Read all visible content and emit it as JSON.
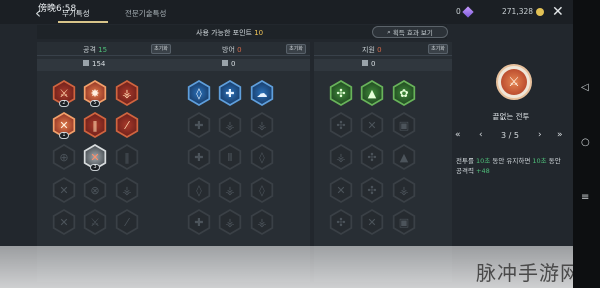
{
  "status": {
    "time": "傍晚6:58"
  },
  "header": {
    "tabs": [
      {
        "label": "무기특성",
        "active": true
      },
      {
        "label": "전문기술특성",
        "active": false
      }
    ],
    "currency": [
      {
        "icon": "gem-icon",
        "value": "0"
      },
      {
        "icon": "gold-coin-icon",
        "value": "271,328"
      }
    ]
  },
  "points": {
    "label": "사용 가능한 포인트",
    "value": "10",
    "effect_button": "획득 효과 보기"
  },
  "columns": [
    {
      "title": "공격",
      "count": "15",
      "reset": "초기화",
      "stat_icon": "attack-icon",
      "stat": "154",
      "accent": "#d0643f",
      "nodes": [
        {
          "style": "red",
          "glyph": "⚔",
          "icon": "crossed-swords-icon",
          "level": "2"
        },
        {
          "style": "orange",
          "glyph": "✸",
          "icon": "burst-icon",
          "level": "5"
        },
        {
          "style": "red",
          "glyph": "⚶",
          "icon": "trident-icon",
          "level": ""
        },
        {
          "style": "orange",
          "glyph": "✕",
          "icon": "crossed-blades-icon",
          "level": "1"
        },
        {
          "style": "red",
          "glyph": "‖",
          "icon": "twin-swords-icon",
          "level": ""
        },
        {
          "style": "red",
          "glyph": "⁄",
          "icon": "slash-icon",
          "level": ""
        },
        {
          "style": "dim",
          "glyph": "⊕",
          "icon": "plus-shield-icon",
          "level": ""
        },
        {
          "style": "white",
          "glyph": "✕",
          "icon": "swords-selected-icon",
          "level": "3"
        },
        {
          "style": "dim",
          "glyph": "‖",
          "icon": "pillar-icon",
          "level": ""
        },
        {
          "style": "dim",
          "glyph": "✕",
          "icon": "crossed-swords-icon",
          "level": ""
        },
        {
          "style": "dim",
          "glyph": "⊗",
          "icon": "target-icon",
          "level": ""
        },
        {
          "style": "dim",
          "glyph": "⚶",
          "icon": "trident-icon",
          "level": ""
        },
        {
          "style": "dim",
          "glyph": "✕",
          "icon": "crossed-blades-icon",
          "level": ""
        },
        {
          "style": "dim",
          "glyph": "⚔",
          "icon": "crossed-swords-icon",
          "level": ""
        },
        {
          "style": "dim",
          "glyph": "⁄",
          "icon": "slash-icon",
          "level": ""
        }
      ]
    },
    {
      "title": "방어",
      "count": "0",
      "reset": "초기화",
      "stat_icon": "shield-stat-icon",
      "stat": "0",
      "accent": "#5f9fdc",
      "nodes": [
        {
          "style": "blue",
          "glyph": "◊",
          "icon": "shield-icon",
          "level": ""
        },
        {
          "style": "blue",
          "glyph": "✚",
          "icon": "plus-icon",
          "level": ""
        },
        {
          "style": "blue",
          "glyph": "☁",
          "icon": "cloud-shield-icon",
          "level": ""
        },
        {
          "style": "dim",
          "glyph": "✚",
          "icon": "plus-icon",
          "level": ""
        },
        {
          "style": "dim",
          "glyph": "⚶",
          "icon": "trident-icon",
          "level": ""
        },
        {
          "style": "dim",
          "glyph": "⚶",
          "icon": "trident-icon",
          "level": ""
        },
        {
          "style": "dim",
          "glyph": "✚",
          "icon": "plus-icon",
          "level": ""
        },
        {
          "style": "dim",
          "glyph": "Ⅱ",
          "icon": "double-bar-icon",
          "level": ""
        },
        {
          "style": "dim",
          "glyph": "◊",
          "icon": "shield-icon",
          "level": ""
        },
        {
          "style": "dim",
          "glyph": "◊",
          "icon": "shield-icon",
          "level": ""
        },
        {
          "style": "dim",
          "glyph": "⚶",
          "icon": "trident-icon",
          "level": ""
        },
        {
          "style": "dim",
          "glyph": "◊",
          "icon": "shield-icon",
          "level": ""
        },
        {
          "style": "dim",
          "glyph": "✚",
          "icon": "plus-icon",
          "level": ""
        },
        {
          "style": "dim",
          "glyph": "⚶",
          "icon": "trident-icon",
          "level": ""
        },
        {
          "style": "dim",
          "glyph": "⚶",
          "icon": "trident-icon",
          "level": ""
        }
      ]
    },
    {
      "title": "지원",
      "count": "0",
      "reset": "초기화",
      "stat_icon": "support-stat-icon",
      "stat": "0",
      "accent": "#68b35a",
      "nodes": [
        {
          "style": "green",
          "glyph": "✣",
          "icon": "clover-cross-icon",
          "level": ""
        },
        {
          "style": "green",
          "glyph": "▲",
          "icon": "leaf-drop-icon",
          "level": ""
        },
        {
          "style": "green",
          "glyph": "✿",
          "icon": "clover-icon",
          "level": ""
        },
        {
          "style": "dim",
          "glyph": "✣",
          "icon": "cross-icon",
          "level": ""
        },
        {
          "style": "dim",
          "glyph": "✕",
          "icon": "crossed-icon",
          "level": ""
        },
        {
          "style": "dim",
          "glyph": "▣",
          "icon": "chest-icon",
          "level": ""
        },
        {
          "style": "dim",
          "glyph": "⚶",
          "icon": "trident-icon",
          "level": ""
        },
        {
          "style": "dim",
          "glyph": "✣",
          "icon": "cross-icon",
          "level": ""
        },
        {
          "style": "dim",
          "glyph": "▲",
          "icon": "leaf-drop-icon",
          "level": ""
        },
        {
          "style": "dim",
          "glyph": "✕",
          "icon": "crossed-icon",
          "level": ""
        },
        {
          "style": "dim",
          "glyph": "✣",
          "icon": "cross-icon",
          "level": ""
        },
        {
          "style": "dim",
          "glyph": "⚶",
          "icon": "trident-icon",
          "level": ""
        },
        {
          "style": "dim",
          "glyph": "✣",
          "icon": "cross-icon",
          "level": ""
        },
        {
          "style": "dim",
          "glyph": "✕",
          "icon": "crossed-icon",
          "level": ""
        },
        {
          "style": "dim",
          "glyph": "▣",
          "icon": "chest-icon",
          "level": ""
        }
      ]
    }
  ],
  "detail": {
    "icon": "crossed-swords-emblem-icon",
    "name": "끝없는 전투",
    "page_current": "3",
    "page_total": "5",
    "page_separator": "/",
    "desc_prefix": "전투를",
    "desc_sec1": "10초",
    "desc_mid": "동안 유지하면",
    "desc_sec2": "10초",
    "desc_suffix": "동안",
    "desc_stat": "공격력",
    "desc_bonus": "+48"
  },
  "watermark": "脉冲手游网"
}
